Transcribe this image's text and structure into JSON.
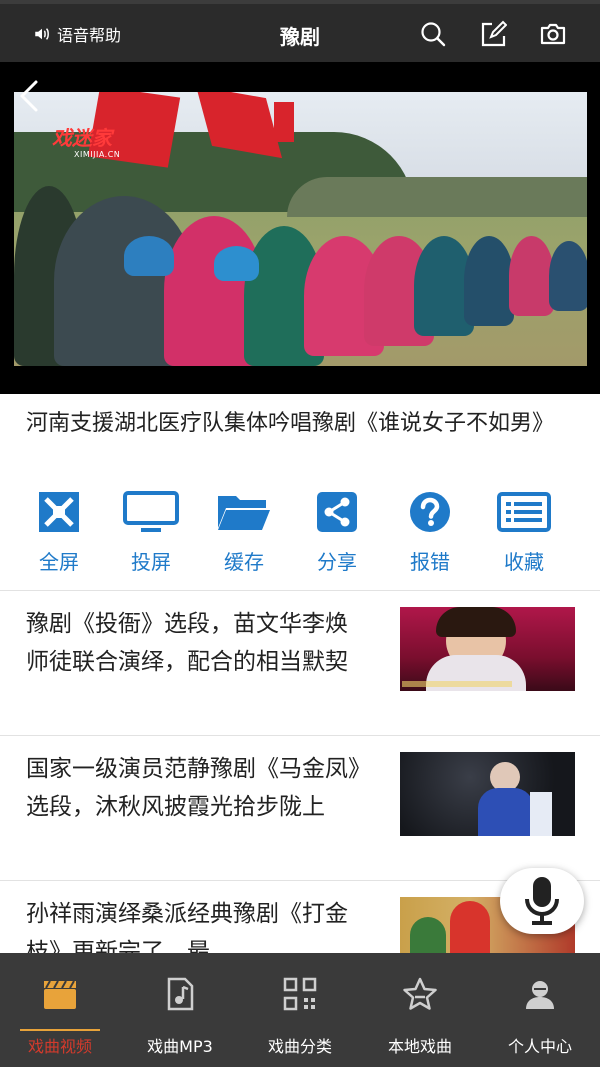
{
  "header": {
    "voice_help": "语音帮助",
    "title": "豫剧",
    "icons": [
      "speaker-icon",
      "search-icon",
      "edit-icon",
      "camera-icon"
    ]
  },
  "video": {
    "watermark": "戏迷家",
    "watermark_url": "XIMIJIA.CN",
    "title": "河南支援湖北医疗队集体吟唱豫剧《谁说女子不如男》"
  },
  "actions": [
    {
      "label": "全屏",
      "icon": "fullscreen-icon"
    },
    {
      "label": "投屏",
      "icon": "monitor-icon"
    },
    {
      "label": "缓存",
      "icon": "folder-icon"
    },
    {
      "label": "分享",
      "icon": "share-icon"
    },
    {
      "label": "报错",
      "icon": "question-icon"
    },
    {
      "label": "收藏",
      "icon": "list-icon"
    }
  ],
  "list": [
    {
      "title": "豫剧《投衙》选段，苗文华李焕师徒联合演绎，配合的相当默契"
    },
    {
      "title": "国家一级演员范静豫剧《马金凤》选段，沐秋风披霞光拾步陇上"
    },
    {
      "title": "孙祥雨演绎桑派经典豫剧《打金枝》更新完了，最"
    }
  ],
  "bottom_nav": [
    {
      "label": "戏曲视频",
      "icon": "clapperboard-icon",
      "active": true
    },
    {
      "label": "戏曲MP3",
      "icon": "music-file-icon",
      "active": false
    },
    {
      "label": "戏曲分类",
      "icon": "qr-grid-icon",
      "active": false
    },
    {
      "label": "本地戏曲",
      "icon": "star-icon",
      "active": false
    },
    {
      "label": "个人中心",
      "icon": "user-icon",
      "active": false
    }
  ],
  "colors": {
    "header_bg": "#2b2b2b",
    "accent_blue": "#1f7ac9",
    "nav_bg": "#3a3a3a",
    "nav_active": "#d33a2c",
    "nav_active_icon": "#e8a33a"
  }
}
